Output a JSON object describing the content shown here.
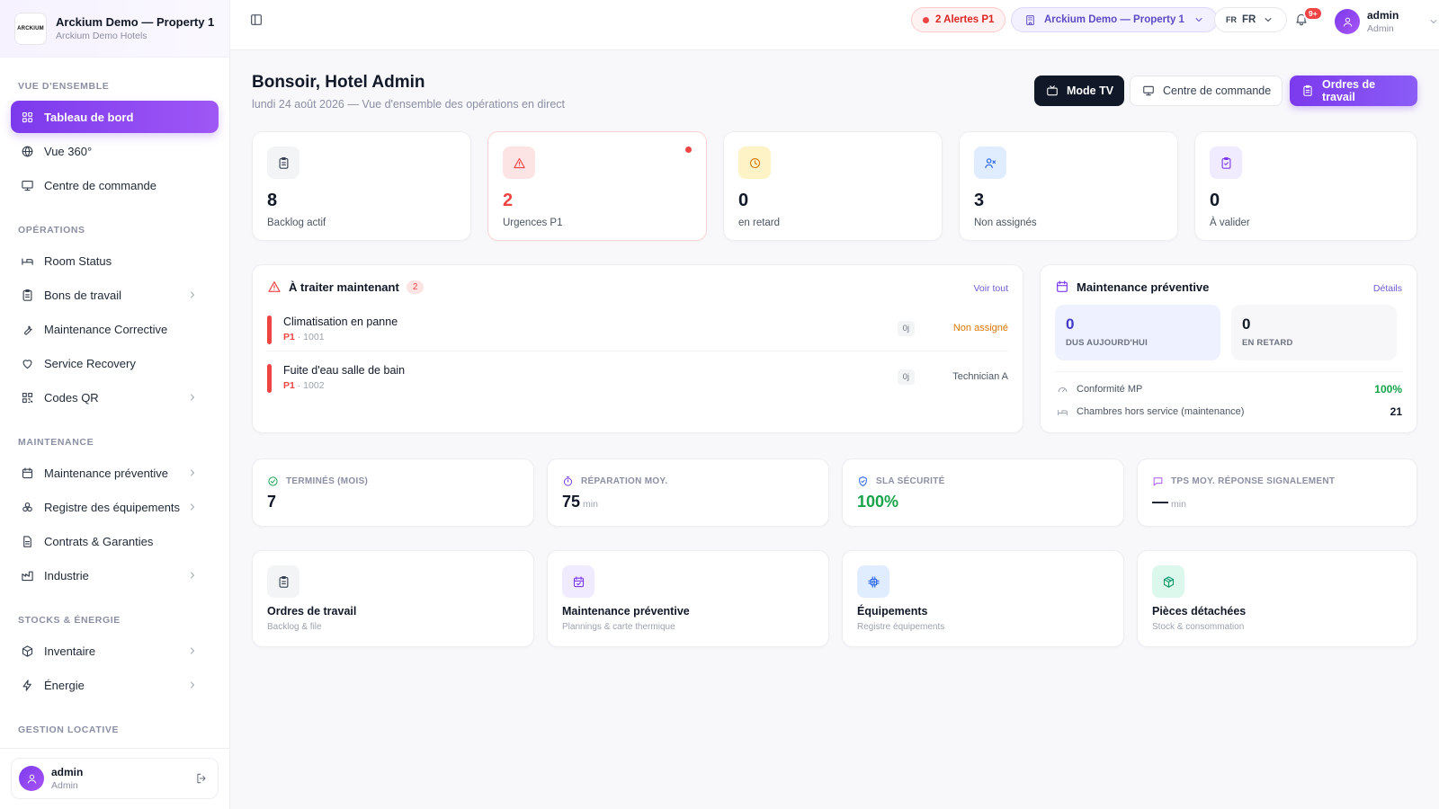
{
  "brand": {
    "logo_text": "ARCKIUM",
    "title": "Arckium Demo — Property 1",
    "subtitle": "Arckium Demo Hotels"
  },
  "sidebar": {
    "sections": [
      {
        "label": "VUE D'ENSEMBLE"
      },
      {
        "label": "OPÉRATIONS"
      },
      {
        "label": "MAINTENANCE"
      },
      {
        "label": "STOCKS & ÉNERGIE"
      },
      {
        "label": "GESTION LOCATIVE"
      }
    ],
    "items": [
      {
        "label": "Tableau de bord",
        "icon": "grid-icon",
        "active": true
      },
      {
        "label": "Vue 360°",
        "icon": "globe-icon"
      },
      {
        "label": "Centre de commande",
        "icon": "monitor-icon"
      },
      {
        "label": "Room Status",
        "icon": "bed-icon"
      },
      {
        "label": "Bons de travail",
        "icon": "clipboard-icon",
        "chevron": true
      },
      {
        "label": "Maintenance Corrective",
        "icon": "wrench-icon"
      },
      {
        "label": "Service Recovery",
        "icon": "heart-icon"
      },
      {
        "label": "Codes QR",
        "icon": "qr-icon",
        "chevron": true
      },
      {
        "label": "Maintenance préventive",
        "icon": "calendar-icon",
        "chevron": true
      },
      {
        "label": "Registre des équipements",
        "icon": "cogs-icon",
        "chevron": true
      },
      {
        "label": "Contrats & Garanties",
        "icon": "document-icon"
      },
      {
        "label": "Industrie",
        "icon": "factory-icon",
        "chevron": true
      },
      {
        "label": "Inventaire",
        "icon": "box-icon",
        "chevron": true
      },
      {
        "label": "Énergie",
        "icon": "bolt-icon",
        "chevron": true
      }
    ],
    "user": {
      "name": "admin",
      "role": "Admin"
    }
  },
  "topbar": {
    "alerts_label": "2 Alertes P1",
    "property_label": "Arckium Demo — Property 1",
    "lang_flag": "FR",
    "lang_label": "FR",
    "notif_count": "9+",
    "user_name": "admin",
    "user_role": "Admin"
  },
  "header": {
    "greeting": "Bonsoir, Hotel Admin",
    "subtitle": "lundi 24 août 2026 — Vue d'ensemble des opérations en direct",
    "btn_tv": "Mode TV",
    "btn_command": "Centre de commande",
    "btn_orders": "Ordres de travail"
  },
  "stats": [
    {
      "value": "8",
      "label": "Backlog actif",
      "icon": "clipboard-icon",
      "color": "#374151",
      "bg": "#f3f4f6"
    },
    {
      "value": "2",
      "label": "Urgences P1",
      "icon": "warning-icon",
      "color": "#ef4444",
      "bg": "#fde4e4"
    },
    {
      "value": "0",
      "label": "en retard",
      "icon": "clock-icon",
      "color": "#d97706",
      "bg": "#fef3c7"
    },
    {
      "value": "3",
      "label": "Non assignés",
      "icon": "user-x-icon",
      "color": "#2563eb",
      "bg": "#e0ecff"
    },
    {
      "value": "0",
      "label": "À valider",
      "icon": "clipboard-check-icon",
      "color": "#7c3aed",
      "bg": "#f1ebff"
    }
  ],
  "urgent": {
    "title": "À traiter maintenant",
    "count": "2",
    "link": "Voir tout",
    "tasks": [
      {
        "title": "Climatisation en panne",
        "priority": "P1",
        "room": " · 1001",
        "days": "0j",
        "assignee": "Non assigné",
        "assignee_color": "#d97706"
      },
      {
        "title": "Fuite d'eau salle de bain",
        "priority": "P1",
        "room": " · 1002",
        "days": "0j",
        "assignee": "Technician A",
        "assignee_color": "#4b5563"
      }
    ]
  },
  "preventive": {
    "title": "Maintenance préventive",
    "link": "Détails",
    "due_today_value": "0",
    "due_today_label": "DUS AUJOURD'HUI",
    "late_value": "0",
    "late_label": "EN RETARD",
    "compliance_label": "Conformité MP",
    "compliance_value": "100%",
    "rooms_label": "Chambres hors service (maintenance)",
    "rooms_value": "21"
  },
  "kpis": [
    {
      "label": "TERMINÉS (MOIS)",
      "value": "7",
      "unit": "",
      "icon": "check-circle-icon",
      "color": "#16a34a",
      "value_color": "#111827"
    },
    {
      "label": "RÉPARATION MOY.",
      "value": "75",
      "unit": "min",
      "icon": "stopwatch-icon",
      "color": "#7c3aed",
      "value_color": "#111827"
    },
    {
      "label": "SLA SÉCURITÉ",
      "value": "100%",
      "unit": "",
      "icon": "shield-icon",
      "color": "#2563eb",
      "value_color": "#16a34a"
    },
    {
      "label": "TPS MOY. RÉPONSE SIGNALEMENT",
      "value": "—",
      "unit": "min",
      "icon": "message-icon",
      "color": "#a855f7",
      "value_color": "#111827"
    }
  ],
  "modules": [
    {
      "title": "Ordres de travail",
      "subtitle": "Backlog & file",
      "icon": "clipboard-icon",
      "color": "#374151",
      "bg": "#f3f4f6"
    },
    {
      "title": "Maintenance préventive",
      "subtitle": "Plannings & carte thermique",
      "icon": "calendar-check-icon",
      "color": "#7c3aed",
      "bg": "#f1ebff"
    },
    {
      "title": "Équipements",
      "subtitle": "Registre équipements",
      "icon": "chip-icon",
      "color": "#2563eb",
      "bg": "#e0ecff"
    },
    {
      "title": "Pièces détachées",
      "subtitle": "Stock & consommation",
      "icon": "package-icon",
      "color": "#059669",
      "bg": "#dcf7ec"
    }
  ]
}
